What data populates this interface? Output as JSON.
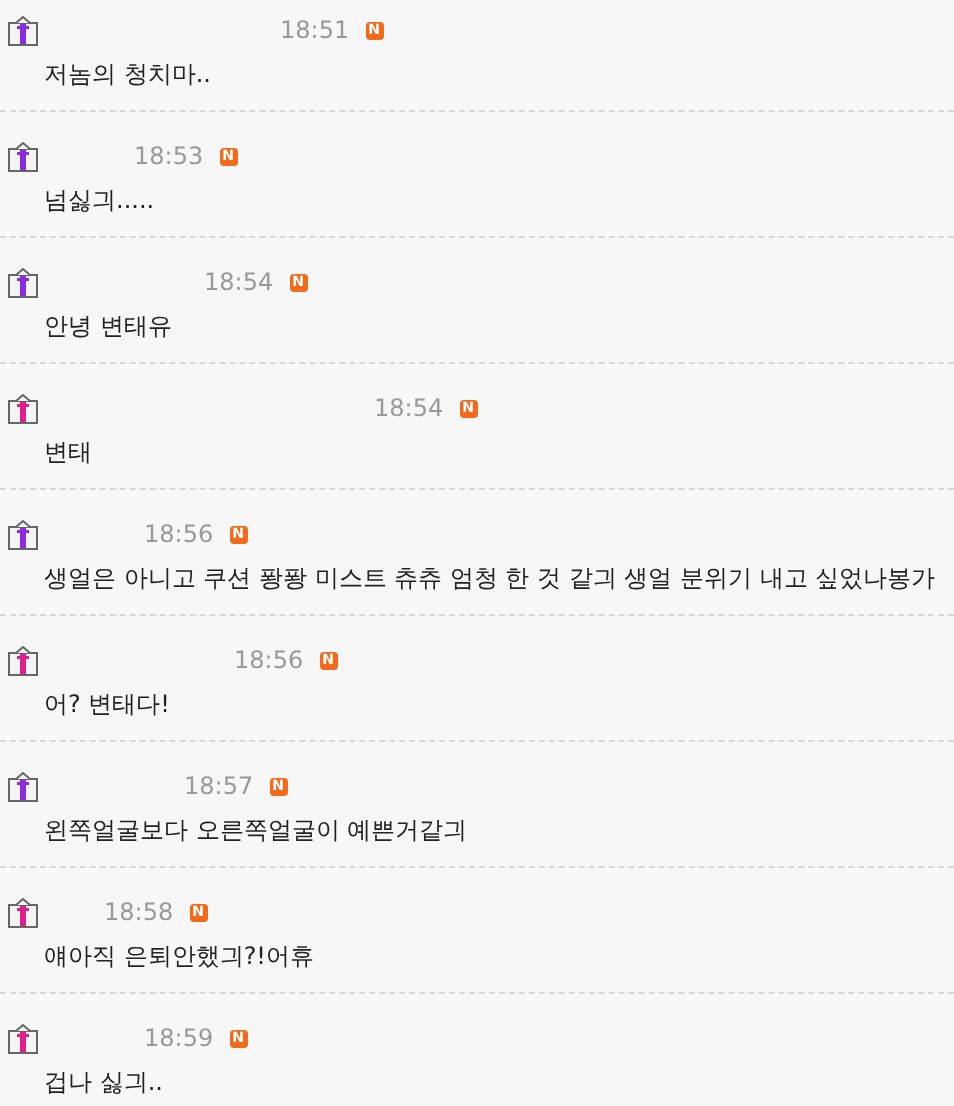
{
  "comments": [
    {
      "time": "18:51",
      "badge": "N",
      "text": "저놈의 청치마..",
      "color": "#8a2be2"
    },
    {
      "time": "18:53",
      "badge": "N",
      "text": "넘싫긔.....",
      "color": "#8a2be2"
    },
    {
      "time": "18:54",
      "badge": "N",
      "text": "안녕 변태유",
      "color": "#8a2be2"
    },
    {
      "time": "18:54",
      "badge": "N",
      "text": "변태",
      "color": "#e0208a"
    },
    {
      "time": "18:56",
      "badge": "N",
      "text": "생얼은 아니고 쿠션 퐝퐝 미스트 츄츄 엄청 한 것 같긔 생얼 분위기 내고 싶었나봉가",
      "color": "#8a2be2"
    },
    {
      "time": "18:56",
      "badge": "N",
      "text": "어? 변태다!",
      "color": "#e0208a"
    },
    {
      "time": "18:57",
      "badge": "N",
      "text": "왼쪽얼굴보다 오른쪽얼굴이 예쁜거같긔",
      "color": "#8a2be2"
    },
    {
      "time": "18:58",
      "badge": "N",
      "text": "얘아직 은퇴안했긔?!어휴",
      "color": "#e0208a"
    },
    {
      "time": "18:59",
      "badge": "N",
      "text": "겁나 싫긔..",
      "color": "#e0208a"
    }
  ]
}
